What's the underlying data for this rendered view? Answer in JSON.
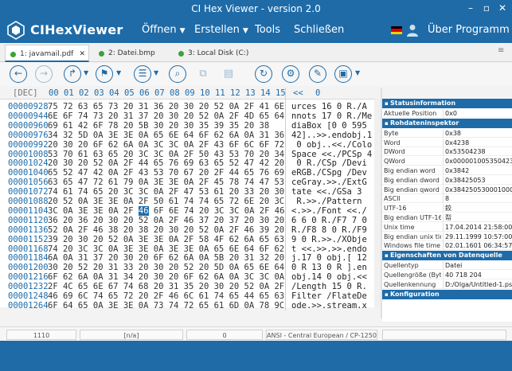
{
  "window": {
    "title": "CI Hex Viewer - version 2.0"
  },
  "menubar": {
    "app_name": "CIHexViewer",
    "items": [
      {
        "label": "Öffnen"
      },
      {
        "label": "Erstellen"
      },
      {
        "label": "Tools"
      },
      {
        "label": "Schließen"
      }
    ],
    "about": "Über Programm"
  },
  "tabs": [
    {
      "label": "1: javamail.pdf",
      "active": true
    },
    {
      "label": "2: Datei.bmp",
      "active": false
    },
    {
      "label": "3: Local Disk (C:)",
      "active": false
    }
  ],
  "hex": {
    "offset_mode": "[DEC]",
    "columns": [
      "00",
      "01",
      "02",
      "03",
      "04",
      "05",
      "06",
      "07",
      "08",
      "09",
      "10",
      "11",
      "12",
      "13",
      "14",
      "15",
      "<<",
      "0"
    ],
    "offsets": [
      "00000928",
      "00000944",
      "00000960",
      "00000976",
      "00000992",
      "00001008",
      "00001024",
      "00001040",
      "00001056",
      "00001072",
      "00001088",
      "00001104",
      "00001120",
      "00001136",
      "00001152",
      "00001168",
      "00001184",
      "00001200",
      "00001216",
      "00001232",
      "00001248",
      "00001264"
    ],
    "bytes": [
      "75 72 63 65 73 20 31 36 20 30 20 52 0A 2F 41 6E",
      "6E 6F 74 73 20 31 37 20 30 20 52 0A 2F 4D 65 64",
      "69 61 42 6F 78 20 5B 30 20 30 35 39 35 20 38",
      "34 32 5D 0A 3E 3E 0A 65 6E 64 6F 62 6A 0A 31 36",
      "20 30 20 6F 62 6A 0A 3C 3C 0A 2F 43 6F 6C 6F 72",
      "53 70 61 63 65 20 3C 3C 0A 2F 50 43 53 70 20 34",
      "20 30 20 52 0A 2F 44 65 76 69 63 65 52 47 42 20",
      "65 52 47 42 0A 2F 43 53 70 67 20 2F 44 65 76 69",
      "63 65 47 72 61 79 0A 3E 3E 0A 2F 45 78 74 47 53",
      "74 61 74 65 20 3C 3C 0A 2F 47 53 61 20 33 20 30",
      "20 52 0A 3E 3E 0A 2F 50 61 74 74 65 72 6E 20 3C",
      "3C 0A 3E 3E 0A 2F 46 6F 6E 74 20 3C 3C 0A 2F 46",
      "36 20 36 20 30 20 52 0A 2F 46 37 20 37 20 30 20",
      "52 0A 2F 46 38 20 38 20 30 20 52 0A 2F 46 39 20",
      "39 20 30 20 52 0A 3E 3E 0A 2F 58 4F 62 6A 65 63",
      "74 20 3C 3C 0A 3E 3E 0A 3E 3E 0A 65 6E 64 6F 62",
      "6A 0A 31 37 20 30 20 6F 62 6A 0A 5B 20 31 32 20",
      "30 20 52 20 31 33 20 30 20 52 20 5D 0A 65 6E 64",
      "6F 62 6A 0A 31 34 20 30 20 6F 62 6A 0A 3C 3C 0A",
      "2F 4C 65 6E 67 74 68 20 31 35 20 30 20 52 0A 2F",
      "46 69 6C 74 65 72 20 2F 46 6C 61 74 65 44 65 63",
      "6F 64 65 0A 3E 3E 0A 73 74 72 65 61 6D 0A 78 9C"
    ],
    "selected_row": 11,
    "selected_byte": "46",
    "ascii": [
      "urces 16 0 R./A",
      "nnots 17 0 R./Me",
      "diaBox [0 0 595",
      "42]..>>.endobj.1",
      " 0 obj..<<./Colo",
      "Space <<./PCSp 4",
      " 0 R./CSp /Devi",
      "eRGB./CSpg /Dev",
      "ceGray.>>./ExtG",
      "tate <<./GSa 3 ",
      " R.>>./Pattern ",
      "<.>>./Font <<./",
      "6 6 0 R./F7 7 0",
      "R./F8 8 0 R./F9",
      "9 0 R.>>./XObje",
      "t <<.>>.>>.endo",
      "j.17 0 obj.[ 12",
      "0 R 13 0 R ].en",
      "obj.14 0 obj.<<",
      "/Length 15 0 R.",
      "Filter /FlateDe",
      "ode.>>.stream.x"
    ]
  },
  "panel": {
    "status_header": "Statusinformation",
    "status_rows": [
      {
        "k": "Aktuelle Position",
        "v": "0x0"
      }
    ],
    "data_header": "Rohdateninspektor",
    "data_rows": [
      {
        "k": "Byte",
        "v": "0x38"
      },
      {
        "k": "Word",
        "v": "0x4238"
      },
      {
        "k": "DWord",
        "v": "0x53504238"
      },
      {
        "k": "QWord",
        "v": "0x000001005350423"
      },
      {
        "k": "Big endian word",
        "v": "0x3842"
      },
      {
        "k": "Big endian dword",
        "v": "0x38425053"
      },
      {
        "k": "Big endian qword",
        "v": "0x3842505300010000"
      },
      {
        "k": "ASCII",
        "v": "8"
      },
      {
        "k": "UTF-16",
        "v": "鉸"
      },
      {
        "k": "Big endian UTF-16",
        "v": "㡂"
      },
      {
        "k": "Unix time",
        "v": "17.04.2014 21:58:00"
      },
      {
        "k": "Big endian unix time",
        "v": "29.11.1999 10:57:00"
      },
      {
        "k": "Windows file time",
        "v": "02.01.1601 06:34:57"
      }
    ],
    "file_header": "Eigenschaften von Datenquelle",
    "file_rows": [
      {
        "k": "Quellentyp",
        "v": "Datei"
      },
      {
        "k": "Quellengröße (Byt...",
        "v": "40 718 204"
      },
      {
        "k": "Quellenkennung",
        "v": "D:/Olga/Untitled-1.ps"
      }
    ],
    "config_header": "Konfiguration"
  },
  "status": {
    "position": "1110",
    "na": "[n/a]",
    "zero": "0",
    "encoding": "ANSI - Central European / CP-1250"
  },
  "colors": {
    "accent": "#1e6ba8"
  }
}
